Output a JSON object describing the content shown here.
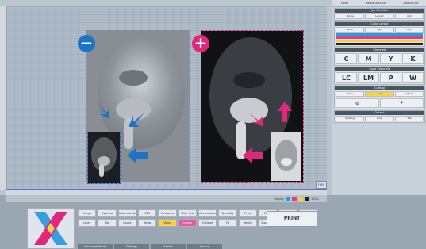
{
  "canvas": {
    "left_badge": "−",
    "right_badge": "+",
    "corner_button": "FREE"
  },
  "colors": {
    "minus_badge": "#1e73c8",
    "plus_badge": "#e0287a",
    "guide_line": "#5a6fd0",
    "highlight": "#f3d34a"
  },
  "right_panel": {
    "tabs": [
      "Mode",
      "Media Defaults",
      "Add layout"
    ],
    "sections": [
      {
        "title": "Job Creation",
        "cells": [
          "Media",
          "Layout",
          "Add"
        ]
      },
      {
        "title": "Color Layout",
        "cells": [
          "Solid",
          "Spot",
          "Def"
        ]
      },
      {
        "title": "Channels",
        "letters": [
          "C",
          "M",
          "Y",
          "K"
        ]
      },
      {
        "title": "Light Channels",
        "letters": [
          "LC",
          "LM",
          "P",
          "W"
        ]
      },
      {
        "title": "Cutting",
        "cells": [
          "Mirror",
          "Cut",
          "Offset"
        ]
      },
      {
        "title": "Output",
        "cells": [
          "Nesting",
          "Crop",
          "Tile"
        ]
      }
    ]
  },
  "status": {
    "label": "Display",
    "zoom": "100%"
  },
  "controls": {
    "buttons": [
      "Range",
      "Optimal",
      "Spot selection",
      "100",
      "Red area",
      "Hide first",
      "Accumulate",
      "Quantity",
      "Print",
      "Move",
      "Scale",
      "Dual",
      "Lines",
      "Flip",
      "Count",
      "Skew",
      "Warp",
      "Layers",
      "Cutlines",
      "Fit",
      "Resize",
      "Duplicate",
      "Overlay",
      "Template"
    ],
    "print_label": "PRINT",
    "tabs": [
      "Advanced Mode",
      "Settings",
      "Export",
      "Queue"
    ]
  }
}
